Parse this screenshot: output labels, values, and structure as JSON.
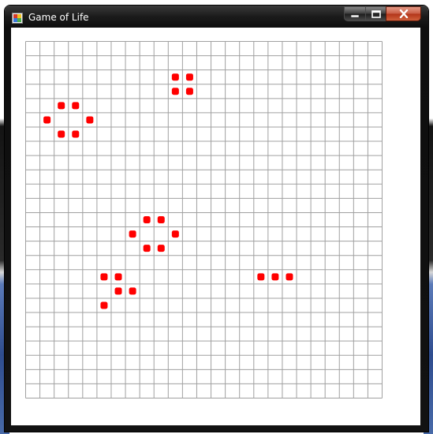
{
  "window": {
    "title": "Game of Life",
    "icon": "app-icon",
    "controls": {
      "minimize_icon": "minimize-icon",
      "maximize_icon": "maximize-icon",
      "close_icon": "close-icon",
      "close_color": "#c94b2e"
    }
  },
  "board": {
    "columns": 25,
    "rows": 25,
    "grid_color": "#a0a0a0",
    "cell_color": "#ff0000",
    "live_cells": [
      [
        10,
        2
      ],
      [
        11,
        2
      ],
      [
        10,
        3
      ],
      [
        11,
        3
      ],
      [
        2,
        4
      ],
      [
        3,
        4
      ],
      [
        1,
        5
      ],
      [
        4,
        5
      ],
      [
        2,
        6
      ],
      [
        3,
        6
      ],
      [
        8,
        12
      ],
      [
        9,
        12
      ],
      [
        7,
        13
      ],
      [
        10,
        13
      ],
      [
        8,
        14
      ],
      [
        9,
        14
      ],
      [
        5,
        16
      ],
      [
        6,
        16
      ],
      [
        16,
        16
      ],
      [
        17,
        16
      ],
      [
        18,
        16
      ],
      [
        6,
        17
      ],
      [
        7,
        17
      ],
      [
        5,
        18
      ]
    ]
  }
}
